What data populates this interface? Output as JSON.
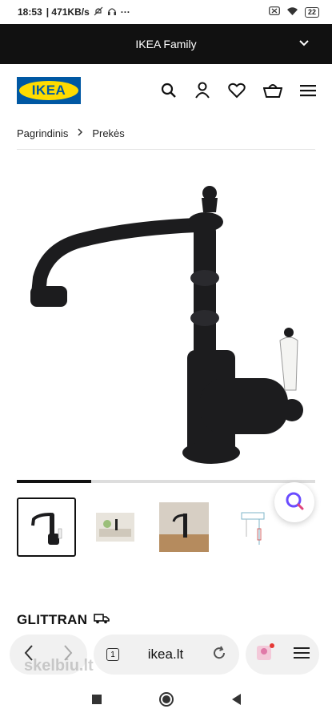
{
  "status_bar": {
    "time": "18:53",
    "speed": "| 471KB/s",
    "battery": "22"
  },
  "banner": {
    "label": "IKEA Family"
  },
  "header": {
    "logo_text": "IKEA"
  },
  "breadcrumb": {
    "items": [
      "Pagrindinis",
      "Prekės"
    ]
  },
  "gallery": {
    "progress": 0.25,
    "thumbnail_count": 4,
    "selected_index": 0
  },
  "product": {
    "name": "GLITTRAN"
  },
  "browser": {
    "tab_count": "1",
    "url": "ikea.lt"
  },
  "watermark": "skelbiu.lt",
  "colors": {
    "accent_blue": "#0058a3",
    "accent_yellow": "#ffdb00",
    "banner_bg": "#111111"
  }
}
